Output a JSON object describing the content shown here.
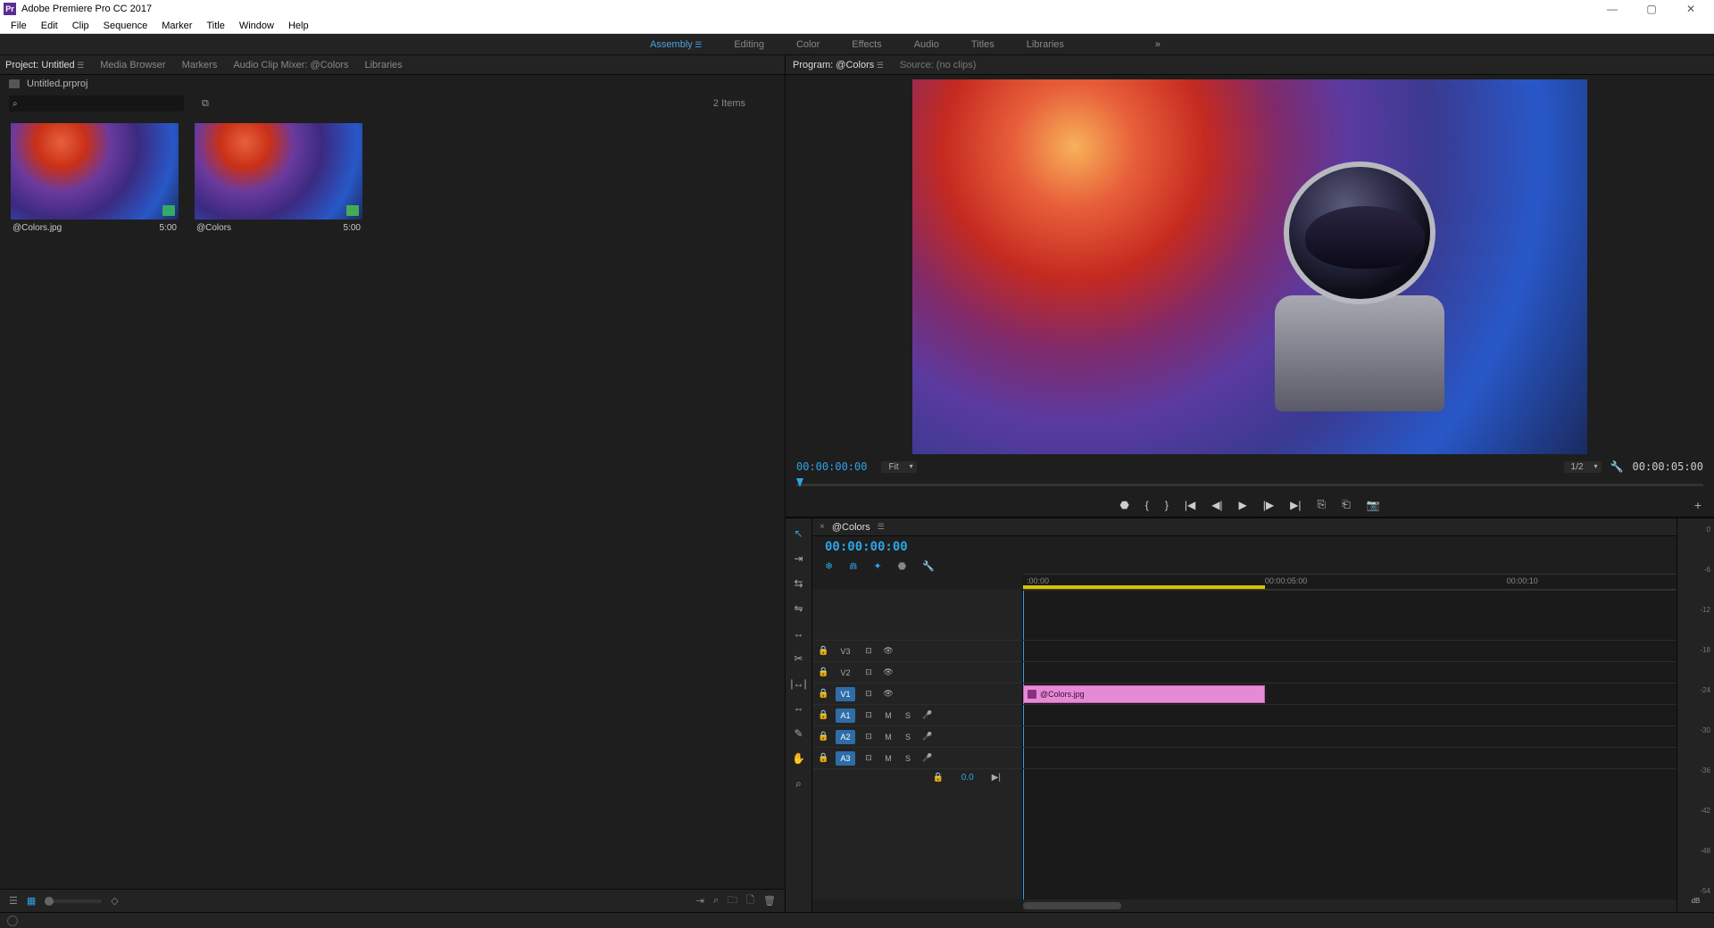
{
  "app": {
    "title": "Adobe Premiere Pro CC 2017"
  },
  "menu": [
    "File",
    "Edit",
    "Clip",
    "Sequence",
    "Marker",
    "Title",
    "Window",
    "Help"
  ],
  "workspaces": {
    "items": [
      "Assembly",
      "Editing",
      "Color",
      "Effects",
      "Audio",
      "Titles",
      "Libraries"
    ],
    "active": 0
  },
  "project_panel": {
    "tabs": [
      "Project: Untitled",
      "Media Browser",
      "Markers",
      "Audio Clip Mixer: @Colors",
      "Libraries"
    ],
    "active": 0,
    "project_file": "Untitled.prproj",
    "search_placeholder": "",
    "item_count": "2 Items",
    "items": [
      {
        "name": "@Colors.jpg",
        "duration": "5:00",
        "type": "image"
      },
      {
        "name": "@Colors",
        "duration": "5:00",
        "type": "sequence"
      }
    ]
  },
  "program": {
    "tab": "Program: @Colors",
    "source": "Source: (no clips)",
    "timecode": "00:00:00:00",
    "fit": "Fit",
    "zoom": "1/2",
    "duration": "00:00:05:00"
  },
  "transport": {
    "buttons": [
      "marker",
      "in",
      "out",
      "goto-in",
      "step-back",
      "play",
      "step-fwd",
      "goto-out",
      "lift",
      "extract",
      "export-frame"
    ]
  },
  "timeline": {
    "sequence": "@Colors",
    "timecode": "00:00:00:00",
    "ruler": [
      ":00:00",
      "00:00:05:00",
      "00:00:10"
    ],
    "video_tracks": [
      {
        "id": "V3",
        "selected": false
      },
      {
        "id": "V2",
        "selected": false
      },
      {
        "id": "V1",
        "selected": true
      }
    ],
    "audio_tracks": [
      {
        "id": "A1",
        "selected": true
      },
      {
        "id": "A2",
        "selected": true
      },
      {
        "id": "A3",
        "selected": true
      }
    ],
    "master_pan": "0.0",
    "clip": {
      "name": "@Colors.jpg",
      "start_pct": 0,
      "width_pct": 37
    },
    "tools": [
      "selection",
      "track-select",
      "ripple",
      "rolling",
      "rate",
      "slip",
      "slide",
      "razor",
      "pen",
      "hand",
      "zoom"
    ]
  },
  "meters": {
    "ticks": [
      "0",
      "-6",
      "-12",
      "-18",
      "-24",
      "-30",
      "-36",
      "-42",
      "-48",
      "-54"
    ],
    "unit": "dB"
  }
}
